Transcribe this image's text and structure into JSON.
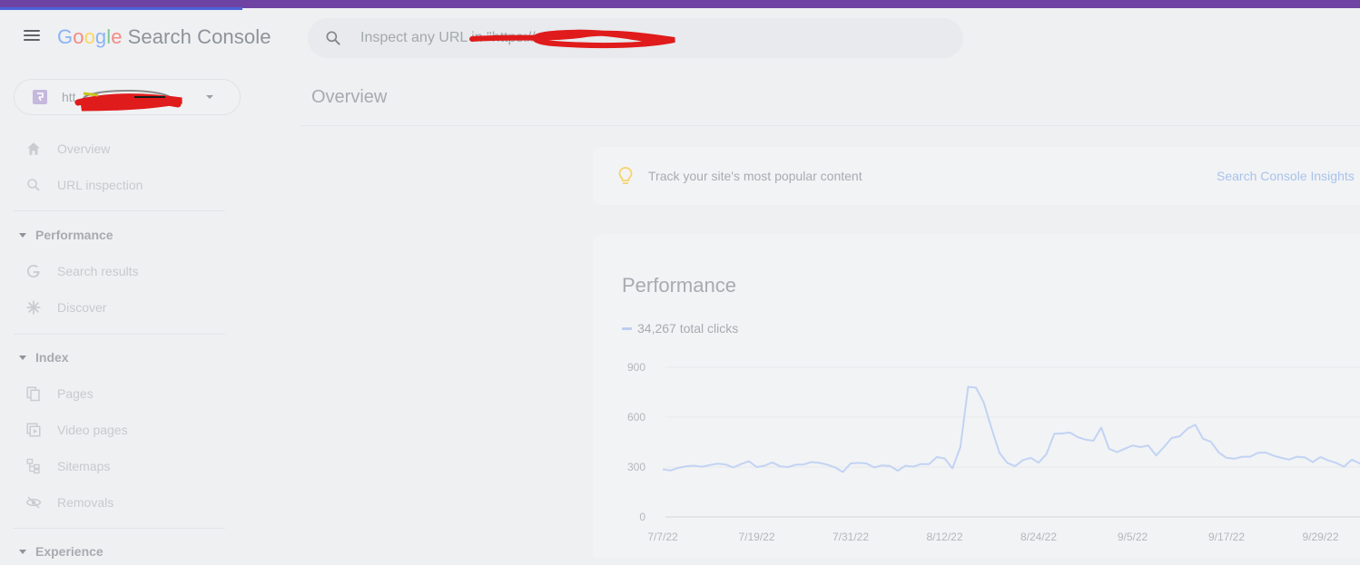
{
  "app": {
    "logo_letters": [
      "G",
      "o",
      "o",
      "g",
      "l",
      "e"
    ],
    "product_name": "Search Console"
  },
  "search": {
    "placeholder": "Inspect any URL in \"https://",
    "icon": "search-icon"
  },
  "property": {
    "label": "htt",
    "icon": "property-icon"
  },
  "page": {
    "title": "Overview"
  },
  "sidebar": {
    "top_items": [
      {
        "label": "Overview",
        "icon": "home-icon"
      },
      {
        "label": "URL inspection",
        "icon": "search-icon"
      }
    ],
    "sections": [
      {
        "title": "Performance",
        "items": [
          {
            "label": "Search results",
            "icon": "google-g-icon"
          },
          {
            "label": "Discover",
            "icon": "asterisk-icon"
          }
        ]
      },
      {
        "title": "Index",
        "items": [
          {
            "label": "Pages",
            "icon": "pages-icon"
          },
          {
            "label": "Video pages",
            "icon": "video-pages-icon"
          },
          {
            "label": "Sitemaps",
            "icon": "sitemap-icon"
          },
          {
            "label": "Removals",
            "icon": "eye-off-icon"
          }
        ]
      },
      {
        "title": "Experience",
        "items": []
      }
    ]
  },
  "tip": {
    "text": "Track your site's most popular content",
    "link": "Search Console Insights",
    "icon": "lightbulb-icon"
  },
  "performance": {
    "title": "Performance",
    "legend": "34,267 total clicks"
  },
  "colors": {
    "accent_bar": "#6f43a4",
    "progress": "#4a63d8",
    "series": "#c2d3f3"
  },
  "chart_data": {
    "type": "line",
    "ylim": [
      0,
      900
    ],
    "yticks": [
      0,
      300,
      600,
      900
    ],
    "xtick_labels": [
      "7/7/22",
      "7/19/22",
      "7/31/22",
      "8/12/22",
      "8/24/22",
      "9/5/22",
      "9/17/22",
      "9/29/22"
    ],
    "grid": true,
    "series": [
      {
        "values": [
          287,
          280,
          295,
          305,
          308,
          302,
          312,
          320,
          316,
          298,
          318,
          335,
          300,
          308,
          328,
          304,
          300,
          314,
          316,
          330,
          325,
          315,
          298,
          270,
          322,
          325,
          322,
          298,
          310,
          307,
          278,
          308,
          302,
          318,
          318,
          360,
          352,
          292,
          420,
          782,
          778,
          688,
          530,
          385,
          325,
          305,
          342,
          355,
          326,
          378,
          500,
          502,
          508,
          480,
          465,
          458,
          538,
          410,
          390,
          410,
          430,
          420,
          430,
          370,
          420,
          475,
          485,
          530,
          555,
          470,
          452,
          388,
          355,
          350,
          362,
          362,
          385,
          388,
          368,
          355,
          345,
          362,
          358,
          330,
          360,
          340,
          325,
          302,
          345,
          322,
          312
        ]
      }
    ]
  }
}
